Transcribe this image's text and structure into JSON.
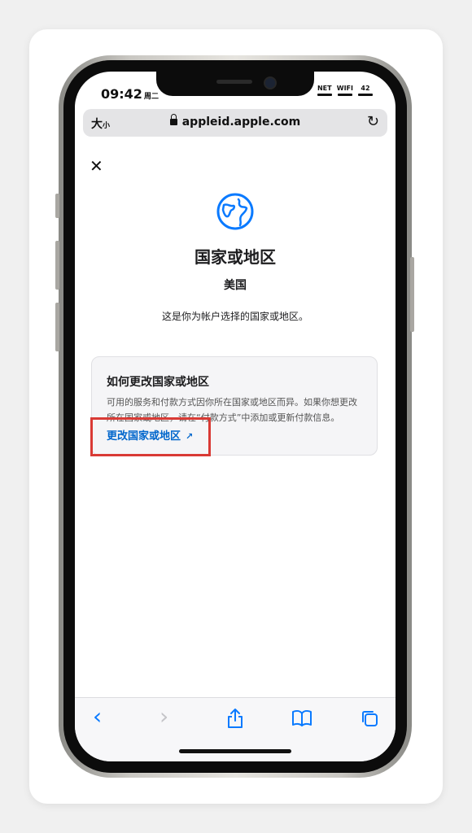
{
  "status_bar": {
    "time": "09:42",
    "time_sub": "周二",
    "network": "NET",
    "wifi": "WIFI",
    "battery": "42"
  },
  "browser": {
    "text_size_label": "大",
    "text_size_small": "小",
    "url": "appleid.apple.com"
  },
  "page": {
    "close_glyph": "✕",
    "title": "国家或地区",
    "country": "美国",
    "description": "这是你为帐户选择的国家或地区。"
  },
  "info_card": {
    "title": "如何更改国家或地区",
    "body": "可用的服务和付款方式因你所在国家或地区而异。如果你想更改所在国家或地区，请在“付款方式”中添加或更新付款信息。",
    "link_label": "更改国家或地区",
    "link_arrow": "↗"
  },
  "toolbar": {
    "back": "‹",
    "forward": "›",
    "share": "⇪",
    "bookmarks": "📖",
    "tabs": "⧉"
  },
  "colors": {
    "accent": "#0066cc",
    "highlight": "#d93a35",
    "toolbar_icon": "#0a7aff"
  }
}
